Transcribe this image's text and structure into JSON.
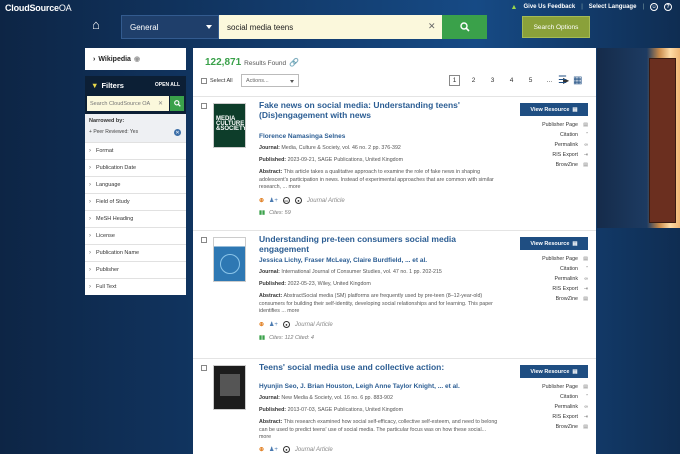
{
  "app": {
    "logo_bold": "CloudSource",
    "logo_light": "OA"
  },
  "topbar": {
    "feedback": "Give Us Feedback",
    "language": "Select Language"
  },
  "search": {
    "scope": "General",
    "query": "social media teens",
    "options_label": "Search Options"
  },
  "sidebar": {
    "wikipedia_label": "Wikipedia",
    "filters_title": "Filters",
    "open_all": "OPEN ALL",
    "filter_search_placeholder": "Search CloudSource OA",
    "narrowed_by": "Narrowed by:",
    "active_filter": "Peer Reviewed: Yes",
    "items": [
      {
        "label": "Format"
      },
      {
        "label": "Publication Date"
      },
      {
        "label": "Language"
      },
      {
        "label": "Field of Study"
      },
      {
        "label": "MeSH Heading"
      },
      {
        "label": "License"
      },
      {
        "label": "Publication Name"
      },
      {
        "label": "Publisher"
      },
      {
        "label": "Full Text"
      }
    ]
  },
  "results_header": {
    "count": "122,871",
    "count_label": "Results Found",
    "select_all": "Select All",
    "actions_placeholder": "Actions...",
    "pages": [
      "1",
      "2",
      "3",
      "4",
      "5",
      "..."
    ]
  },
  "results": [
    {
      "title": "Fake news on social media: Understanding teens' (Dis)engagement with news",
      "authors": "Florence Namasinga Selnes",
      "journal_label": "Journal:",
      "journal": "Media, Culture & Society, vol. 46 no. 2 pp. 376-392",
      "published_label": "Published:",
      "published": "2023-09-21, SAGE Publications, United Kingdom",
      "abstract_label": "Abstract:",
      "abstract": "This article takes a qualitative approach to examine the role of fake news in shaping adolescent's participation in news. Instead of experimental approaches that are common with similar research, ... more",
      "type": "Journal Article",
      "cites": "Cites: 59",
      "thumb_text": "MEDIA CULTURE &SOCIETY"
    },
    {
      "title": "Understanding pre-teen consumers social media engagement",
      "authors": "Jessica Lichy, Fraser McLeay, Claire Burdfield, ... et al.",
      "journal_label": "Journal:",
      "journal": "International Journal of Consumer Studies, vol. 47 no. 1 pp. 202-215",
      "published_label": "Published:",
      "published": "2022-05-23, Wiley, United Kingdom",
      "abstract_label": "Abstract:",
      "abstract": "AbstractSocial media (SM) platforms are frequently used by pre-teen (8–12-year-old) consumers for building their self-identity, developing social relationships and for learning. This paper identifies ... more",
      "type": "Journal Article",
      "cites": "Cites: 112   Cited: 4"
    },
    {
      "title": "Teens' social media use and collective action:",
      "authors": "Hyunjin Seo, J. Brian Houston, Leigh Anne Taylor Knight, ... et al.",
      "journal_label": "Journal:",
      "journal": "New Media & Society, vol. 16 no. 6 pp. 883-902",
      "published_label": "Published:",
      "published": "2013-07-03, SAGE Publications, United Kingdom",
      "abstract_label": "Abstract:",
      "abstract": "This research examined how social self-efficacy, collective self-esteem, and need to belong can be used to predict teens' use of social media. The particular focus was on how these social... more",
      "type": "Journal Article"
    }
  ],
  "side_actions": {
    "view": "View Resource",
    "links": [
      "Publisher Page",
      "Citation",
      "Permalink",
      "RIS Export",
      "BrowZine"
    ]
  }
}
